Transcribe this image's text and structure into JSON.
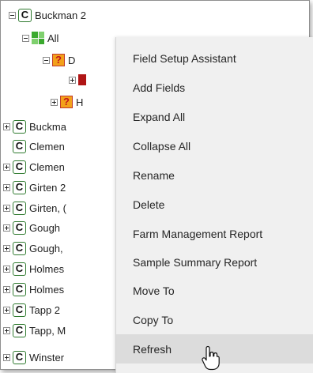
{
  "tree": {
    "rows": [
      {
        "label": "Buckman 2",
        "icon": "c-icon",
        "exp": "minus"
      },
      {
        "label": "All",
        "icon": "grid-icon",
        "exp": "minus"
      },
      {
        "label": "D",
        "icon": "question-icon",
        "exp": "minus"
      },
      {
        "label": "",
        "icon": "flag-icon",
        "exp": "plus"
      },
      {
        "label": "H",
        "icon": "question-icon",
        "exp": "plus"
      },
      {
        "label": "Buckma",
        "icon": "c-icon",
        "exp": "plus"
      },
      {
        "label": "Clemen",
        "icon": "c-icon",
        "exp": "none"
      },
      {
        "label": "Clemen",
        "icon": "c-icon",
        "exp": "plus"
      },
      {
        "label": "Girten 2",
        "icon": "c-icon",
        "exp": "plus"
      },
      {
        "label": "Girten, (",
        "icon": "c-icon",
        "exp": "plus"
      },
      {
        "label": "Gough",
        "icon": "c-icon",
        "exp": "plus"
      },
      {
        "label": "Gough,",
        "icon": "c-icon",
        "exp": "plus"
      },
      {
        "label": "Holmes",
        "icon": "c-icon",
        "exp": "plus"
      },
      {
        "label": "Holmes",
        "icon": "c-icon",
        "exp": "plus"
      },
      {
        "label": "Tapp 2",
        "icon": "c-icon",
        "exp": "plus"
      },
      {
        "label": "Tapp, M",
        "icon": "c-icon",
        "exp": "plus"
      },
      {
        "label": "Winster",
        "icon": "c-icon",
        "exp": "plus"
      }
    ],
    "c_glyph": "C",
    "q_glyph": "?"
  },
  "context_menu": {
    "items": [
      "Field Setup Assistant",
      "Add Fields",
      "Expand All",
      "Collapse All",
      "Rename",
      "Delete",
      "Farm Management Report",
      "Sample Summary Report",
      "Move To",
      "Copy To",
      "Refresh"
    ],
    "hovered_item": "Refresh"
  },
  "colors": {
    "menu_bg": "#f0f0f0",
    "hover_bg": "#dcdcdc",
    "c_icon_border": "#2f7a2f",
    "grid_green": "#3aa92e"
  }
}
